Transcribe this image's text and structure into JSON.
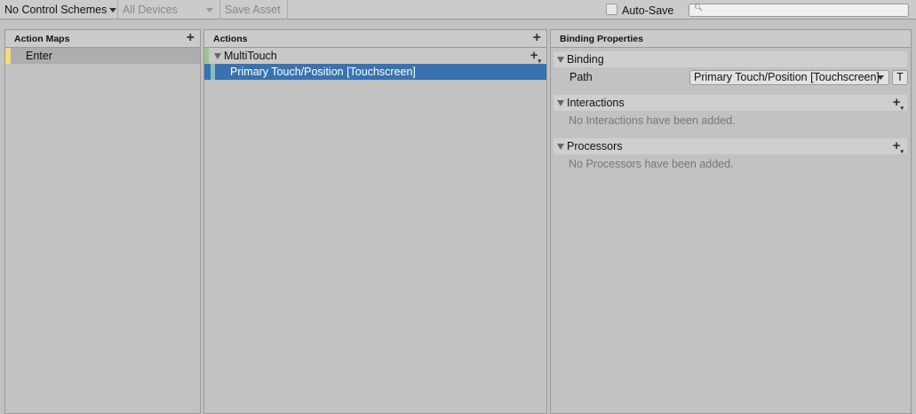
{
  "toolbar": {
    "control_schemes": "No Control Schemes",
    "devices": "All Devices",
    "save_asset": "Save Asset",
    "auto_save": "Auto-Save",
    "search_placeholder": ""
  },
  "action_maps": {
    "title": "Action Maps",
    "items": [
      {
        "label": "Enter",
        "color": "#f5dc7a"
      }
    ]
  },
  "actions": {
    "title": "Actions",
    "items": [
      {
        "label": "MultiTouch",
        "color": "#9bc48e"
      }
    ],
    "bindings": [
      {
        "label": "Primary Touch/Position [Touchscreen]",
        "color": "#8cbcbc"
      }
    ]
  },
  "properties": {
    "title": "Binding Properties",
    "binding": {
      "title": "Binding",
      "path_label": "Path",
      "path_value": "Primary Touch/Position [Touchscreen]",
      "t_button": "T"
    },
    "interactions": {
      "title": "Interactions",
      "empty": "No Interactions have been added."
    },
    "processors": {
      "title": "Processors",
      "empty": "No Processors have been added."
    }
  }
}
